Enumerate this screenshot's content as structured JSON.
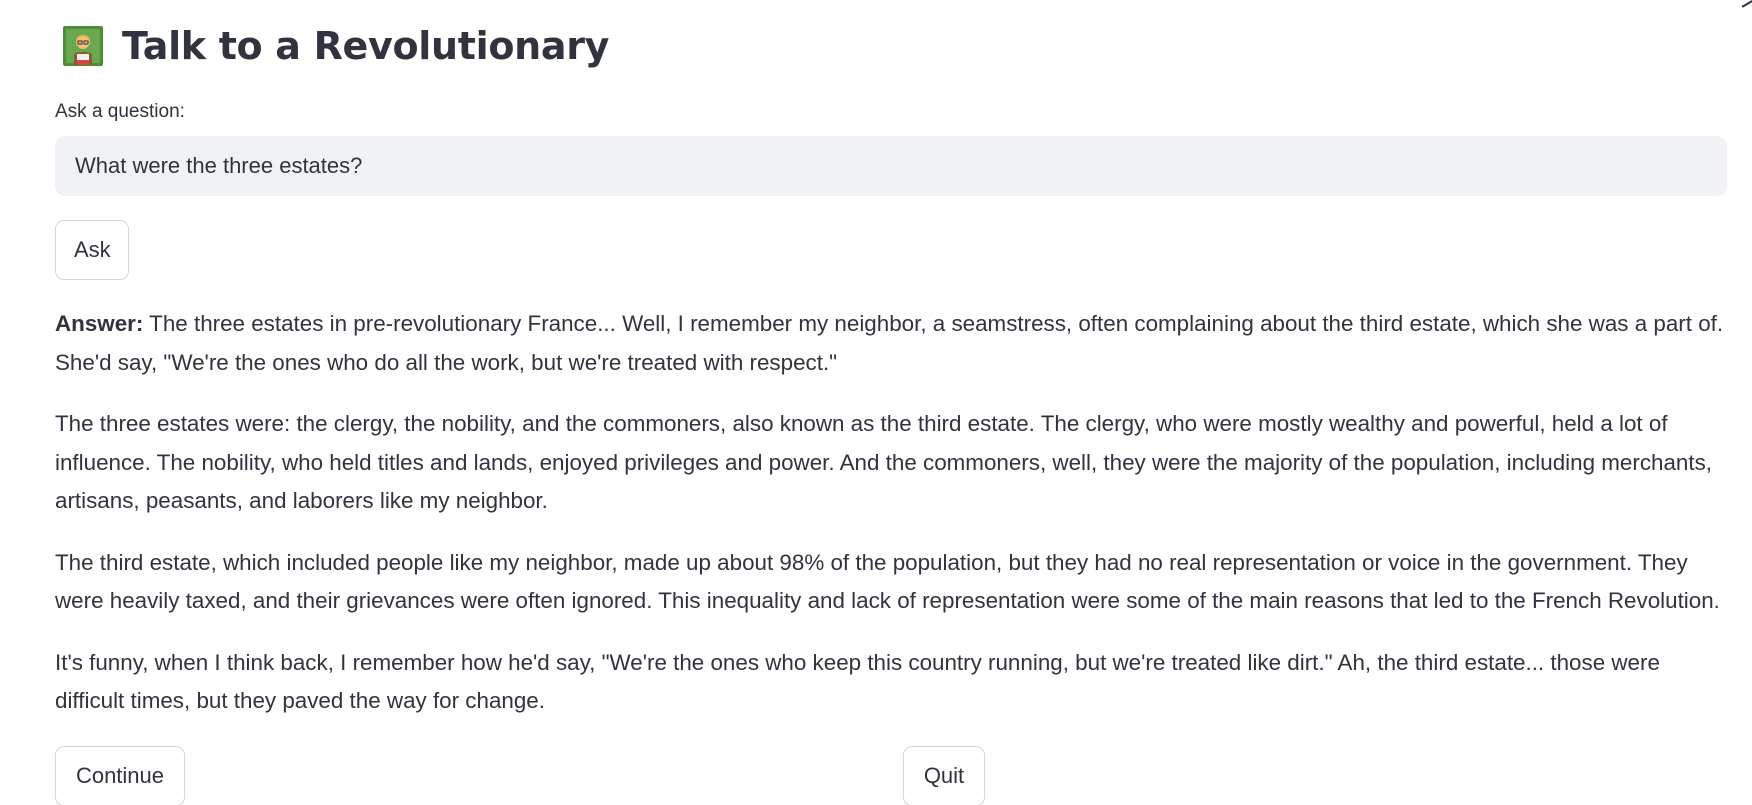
{
  "page": {
    "title": "Talk to a Revolutionary",
    "title_icon": "revolutionary-avatar-icon"
  },
  "question": {
    "label": "Ask a question:",
    "value": "What were the three estates?",
    "ask_label": "Ask"
  },
  "answer": {
    "prefix": "Answer:",
    "paragraphs": [
      "The three estates in pre-revolutionary France... Well, I remember my neighbor, a seamstress, often complaining about the third estate, which she was a part of. She'd say, \"We're the ones who do all the work, but we're treated with respect.\"",
      "The three estates were: the clergy, the nobility, and the commoners, also known as the third estate. The clergy, who were mostly wealthy and powerful, held a lot of influence. The nobility, who held titles and lands, enjoyed privileges and power. And the commoners, well, they were the majority of the population, including merchants, artisans, peasants, and laborers like my neighbor.",
      "The third estate, which included people like my neighbor, made up about 98% of the population, but they had no real representation or voice in the government. They were heavily taxed, and their grievances were often ignored. This inequality and lack of representation were some of the main reasons that led to the French Revolution.",
      "It's funny, when I think back, I remember how he'd say, \"We're the ones who keep this country running, but we're treated like dirt.\" Ah, the third estate... those were difficult times, but they paved the way for change."
    ]
  },
  "actions": {
    "continue_label": "Continue",
    "quit_label": "Quit"
  },
  "colors": {
    "text": "#31333f",
    "input_bg": "#f0f2f6",
    "button_border": "#d6d6d9"
  }
}
